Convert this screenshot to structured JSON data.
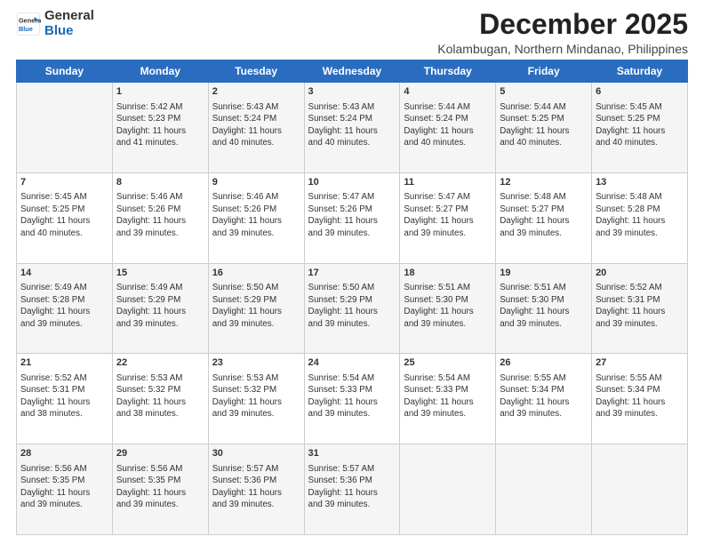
{
  "logo": {
    "line1": "General",
    "line2": "Blue"
  },
  "title": "December 2025",
  "subtitle": "Kolambugan, Northern Mindanao, Philippines",
  "days": [
    "Sunday",
    "Monday",
    "Tuesday",
    "Wednesday",
    "Thursday",
    "Friday",
    "Saturday"
  ],
  "weeks": [
    [
      {
        "date": "",
        "info": ""
      },
      {
        "date": "1",
        "info": "Sunrise: 5:42 AM\nSunset: 5:23 PM\nDaylight: 11 hours\nand 41 minutes."
      },
      {
        "date": "2",
        "info": "Sunrise: 5:43 AM\nSunset: 5:24 PM\nDaylight: 11 hours\nand 40 minutes."
      },
      {
        "date": "3",
        "info": "Sunrise: 5:43 AM\nSunset: 5:24 PM\nDaylight: 11 hours\nand 40 minutes."
      },
      {
        "date": "4",
        "info": "Sunrise: 5:44 AM\nSunset: 5:24 PM\nDaylight: 11 hours\nand 40 minutes."
      },
      {
        "date": "5",
        "info": "Sunrise: 5:44 AM\nSunset: 5:25 PM\nDaylight: 11 hours\nand 40 minutes."
      },
      {
        "date": "6",
        "info": "Sunrise: 5:45 AM\nSunset: 5:25 PM\nDaylight: 11 hours\nand 40 minutes."
      }
    ],
    [
      {
        "date": "7",
        "info": "Sunrise: 5:45 AM\nSunset: 5:25 PM\nDaylight: 11 hours\nand 40 minutes."
      },
      {
        "date": "8",
        "info": "Sunrise: 5:46 AM\nSunset: 5:26 PM\nDaylight: 11 hours\nand 39 minutes."
      },
      {
        "date": "9",
        "info": "Sunrise: 5:46 AM\nSunset: 5:26 PM\nDaylight: 11 hours\nand 39 minutes."
      },
      {
        "date": "10",
        "info": "Sunrise: 5:47 AM\nSunset: 5:26 PM\nDaylight: 11 hours\nand 39 minutes."
      },
      {
        "date": "11",
        "info": "Sunrise: 5:47 AM\nSunset: 5:27 PM\nDaylight: 11 hours\nand 39 minutes."
      },
      {
        "date": "12",
        "info": "Sunrise: 5:48 AM\nSunset: 5:27 PM\nDaylight: 11 hours\nand 39 minutes."
      },
      {
        "date": "13",
        "info": "Sunrise: 5:48 AM\nSunset: 5:28 PM\nDaylight: 11 hours\nand 39 minutes."
      }
    ],
    [
      {
        "date": "14",
        "info": "Sunrise: 5:49 AM\nSunset: 5:28 PM\nDaylight: 11 hours\nand 39 minutes."
      },
      {
        "date": "15",
        "info": "Sunrise: 5:49 AM\nSunset: 5:29 PM\nDaylight: 11 hours\nand 39 minutes."
      },
      {
        "date": "16",
        "info": "Sunrise: 5:50 AM\nSunset: 5:29 PM\nDaylight: 11 hours\nand 39 minutes."
      },
      {
        "date": "17",
        "info": "Sunrise: 5:50 AM\nSunset: 5:29 PM\nDaylight: 11 hours\nand 39 minutes."
      },
      {
        "date": "18",
        "info": "Sunrise: 5:51 AM\nSunset: 5:30 PM\nDaylight: 11 hours\nand 39 minutes."
      },
      {
        "date": "19",
        "info": "Sunrise: 5:51 AM\nSunset: 5:30 PM\nDaylight: 11 hours\nand 39 minutes."
      },
      {
        "date": "20",
        "info": "Sunrise: 5:52 AM\nSunset: 5:31 PM\nDaylight: 11 hours\nand 39 minutes."
      }
    ],
    [
      {
        "date": "21",
        "info": "Sunrise: 5:52 AM\nSunset: 5:31 PM\nDaylight: 11 hours\nand 38 minutes."
      },
      {
        "date": "22",
        "info": "Sunrise: 5:53 AM\nSunset: 5:32 PM\nDaylight: 11 hours\nand 38 minutes."
      },
      {
        "date": "23",
        "info": "Sunrise: 5:53 AM\nSunset: 5:32 PM\nDaylight: 11 hours\nand 39 minutes."
      },
      {
        "date": "24",
        "info": "Sunrise: 5:54 AM\nSunset: 5:33 PM\nDaylight: 11 hours\nand 39 minutes."
      },
      {
        "date": "25",
        "info": "Sunrise: 5:54 AM\nSunset: 5:33 PM\nDaylight: 11 hours\nand 39 minutes."
      },
      {
        "date": "26",
        "info": "Sunrise: 5:55 AM\nSunset: 5:34 PM\nDaylight: 11 hours\nand 39 minutes."
      },
      {
        "date": "27",
        "info": "Sunrise: 5:55 AM\nSunset: 5:34 PM\nDaylight: 11 hours\nand 39 minutes."
      }
    ],
    [
      {
        "date": "28",
        "info": "Sunrise: 5:56 AM\nSunset: 5:35 PM\nDaylight: 11 hours\nand 39 minutes."
      },
      {
        "date": "29",
        "info": "Sunrise: 5:56 AM\nSunset: 5:35 PM\nDaylight: 11 hours\nand 39 minutes."
      },
      {
        "date": "30",
        "info": "Sunrise: 5:57 AM\nSunset: 5:36 PM\nDaylight: 11 hours\nand 39 minutes."
      },
      {
        "date": "31",
        "info": "Sunrise: 5:57 AM\nSunset: 5:36 PM\nDaylight: 11 hours\nand 39 minutes."
      },
      {
        "date": "",
        "info": ""
      },
      {
        "date": "",
        "info": ""
      },
      {
        "date": "",
        "info": ""
      }
    ]
  ]
}
